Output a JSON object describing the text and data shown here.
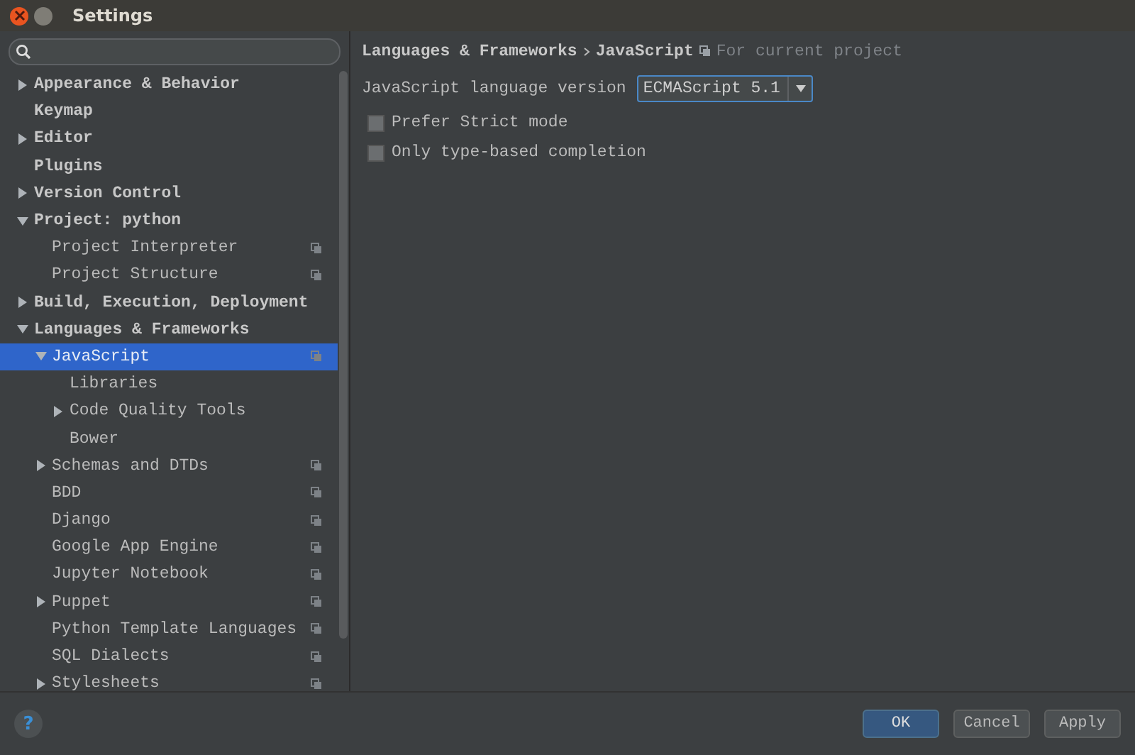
{
  "window": {
    "title": "Settings"
  },
  "tree": [
    {
      "label": "Appearance & Behavior",
      "expanded": false,
      "selected": false,
      "project_scoped": false
    },
    {
      "label": "Keymap",
      "selected": false,
      "project_scoped": false
    },
    {
      "label": "Editor",
      "expanded": false,
      "selected": false,
      "project_scoped": false
    },
    {
      "label": "Plugins",
      "selected": false,
      "project_scoped": false
    },
    {
      "label": "Version Control",
      "expanded": false,
      "selected": false,
      "project_scoped": false
    },
    {
      "label": "Project: python",
      "expanded": true,
      "selected": false,
      "project_scoped": false,
      "children": [
        {
          "label": "Project Interpreter",
          "selected": false,
          "project_scoped": true
        },
        {
          "label": "Project Structure",
          "selected": false,
          "project_scoped": true
        }
      ]
    },
    {
      "label": "Build, Execution, Deployment",
      "expanded": false,
      "selected": false,
      "project_scoped": false
    },
    {
      "label": "Languages & Frameworks",
      "expanded": true,
      "selected": false,
      "project_scoped": false,
      "children": [
        {
          "label": "JavaScript",
          "expanded": true,
          "selected": true,
          "project_scoped": true,
          "children": [
            {
              "label": "Libraries",
              "selected": false,
              "project_scoped": false
            },
            {
              "label": "Code Quality Tools",
              "expanded": false,
              "selected": false,
              "project_scoped": false
            },
            {
              "label": "Bower",
              "selected": false,
              "project_scoped": false
            }
          ]
        },
        {
          "label": "Schemas and DTDs",
          "expanded": false,
          "selected": false,
          "project_scoped": true
        },
        {
          "label": "BDD",
          "selected": false,
          "project_scoped": true
        },
        {
          "label": "Django",
          "selected": false,
          "project_scoped": true
        },
        {
          "label": "Google App Engine",
          "selected": false,
          "project_scoped": true
        },
        {
          "label": "Jupyter Notebook",
          "selected": false,
          "project_scoped": true
        },
        {
          "label": "Puppet",
          "expanded": false,
          "selected": false,
          "project_scoped": true
        },
        {
          "label": "Python Template Languages",
          "selected": false,
          "project_scoped": true
        },
        {
          "label": "SQL Dialects",
          "selected": false,
          "project_scoped": true
        },
        {
          "label": "Stylesheets",
          "expanded": false,
          "selected": false,
          "project_scoped": true
        }
      ]
    }
  ],
  "breadcrumb": {
    "parent": "Languages & Frameworks",
    "current": "JavaScript",
    "scope": "For current project"
  },
  "language_version": {
    "label": "JavaScript language version",
    "value": "ECMAScript 5.1"
  },
  "options": [
    {
      "label": "Prefer Strict mode",
      "checked": false
    },
    {
      "label": "Only type-based completion",
      "checked": false
    }
  ],
  "footer": {
    "help": "?",
    "buttons": [
      {
        "label": "OK",
        "default": true
      },
      {
        "label": "Cancel",
        "default": false
      },
      {
        "label": "Apply",
        "default": false
      }
    ]
  }
}
